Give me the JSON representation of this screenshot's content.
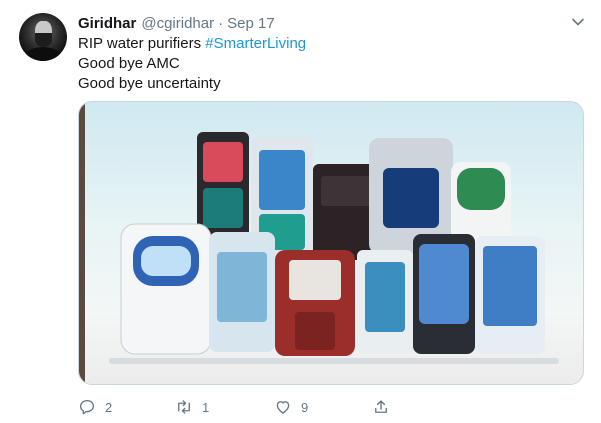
{
  "tweet": {
    "author_name": "Giridhar",
    "author_handle": "@cgiridhar",
    "separator": "·",
    "date": "Sep 17",
    "text_line1_prefix": "RIP water purifiers ",
    "hashtag": "#SmarterLiving",
    "text_line2": "Good bye AMC",
    "text_line3": "Good bye uncertainty",
    "media": {
      "kind": "photo",
      "subject": "water-purifier-units"
    }
  },
  "actions": {
    "reply_count": "2",
    "retweet_count": "1",
    "like_count": "9",
    "share_count": ""
  },
  "icons": {
    "menu": "chevron-down-icon",
    "reply": "reply-icon",
    "retweet": "retweet-icon",
    "like": "heart-icon",
    "share": "share-icon"
  },
  "colors": {
    "link": "#1b95e0",
    "secondary": "#657786",
    "primary_text": "#14171a",
    "border": "#ccd6dd"
  }
}
